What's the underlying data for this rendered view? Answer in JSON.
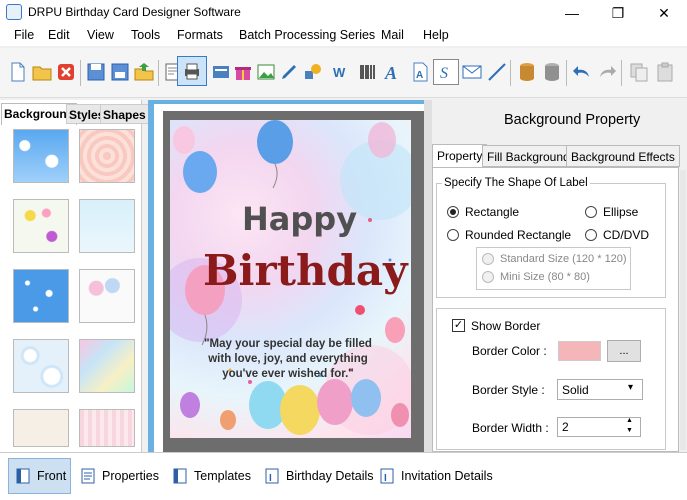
{
  "window": {
    "title": "DRPU Birthday Card Designer Software",
    "minimize": "—",
    "maximize": "❐",
    "close": "✕"
  },
  "menu": [
    "File",
    "Edit",
    "View",
    "Tools",
    "Formats",
    "Batch Processing Series",
    "Mail",
    "Help"
  ],
  "left_tabs": [
    "Background",
    "Styles",
    "Shapes"
  ],
  "card": {
    "line1": "Happy",
    "line2": "Birthday",
    "message": "\"May your special day be filled with love, joy, and everything you've ever wished for.\""
  },
  "right": {
    "heading": "Background Property",
    "tabs": [
      "Property",
      "Fill Background",
      "Background Effects"
    ],
    "shape_group_label": "Specify The Shape Of Label",
    "shapes": {
      "rectangle": "Rectangle",
      "ellipse": "Ellipse",
      "rounded": "Rounded Rectangle",
      "cddvd": "CD/DVD"
    },
    "cd_sizes": {
      "standard": "Standard Size (120 * 120)",
      "mini": "Mini Size (80 * 80)"
    },
    "show_border": "Show Border",
    "border_color_label": "Border Color :",
    "border_color_btn": "...",
    "border_style_label": "Border Style :",
    "border_style_value": "Solid",
    "border_width_label": "Border Width :",
    "border_width_value": "2"
  },
  "bottom_tabs": [
    "Front",
    "Properties",
    "Templates",
    "Birthday Details",
    "Invitation Details"
  ],
  "colors": {
    "border_color_swatch": "#f4b6b8",
    "accent": "#3a78c8",
    "birthday_text": "#8b1a1a"
  }
}
